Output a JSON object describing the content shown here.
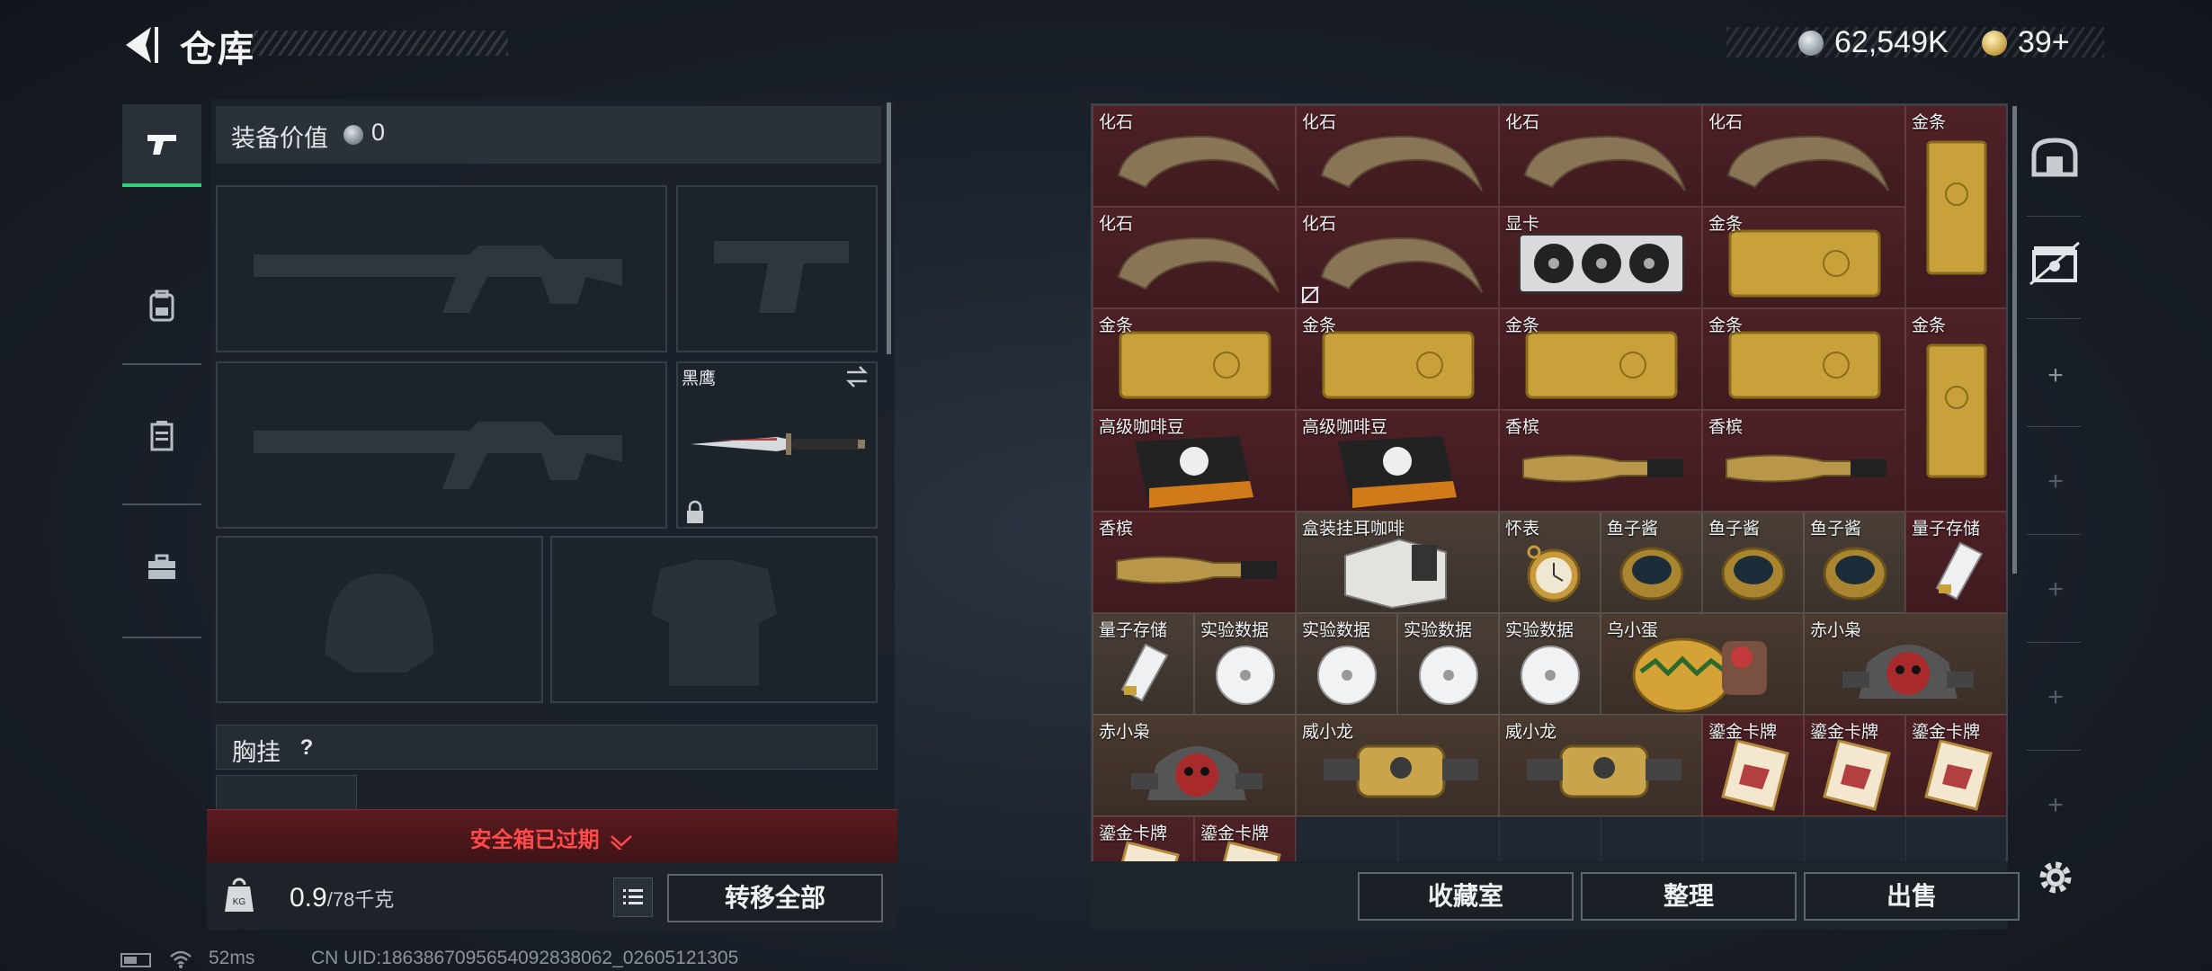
{
  "header": {
    "title": "仓库",
    "back_icon": "back-arrow-icon",
    "silver_currency": "62,549K",
    "gold_currency": "39+"
  },
  "left_tabs": [
    {
      "icon": "pistol-icon",
      "active": true
    },
    {
      "icon": "backpack-icon",
      "active": false
    },
    {
      "icon": "container-icon",
      "active": false
    },
    {
      "icon": "toolbox-icon",
      "active": false
    }
  ],
  "equipment": {
    "value_label": "装备价值",
    "value": "0",
    "melee_name": "黑鹰",
    "vest_label": "胸挂",
    "vest_help": "?",
    "safe_box_status": "安全箱已过期",
    "weight_value": "0.9",
    "weight_max": "/78千克",
    "transfer_all": "转移全部"
  },
  "stash_items": [
    {
      "name": "化石"
    },
    {
      "name": "化石"
    },
    {
      "name": "化石"
    },
    {
      "name": "化石"
    },
    {
      "name": "金条"
    },
    {
      "name": "化石"
    },
    {
      "name": "化石"
    },
    {
      "name": "显卡"
    },
    {
      "name": "金条"
    },
    {
      "name": "金条"
    },
    {
      "name": "金条"
    },
    {
      "name": "金条"
    },
    {
      "name": "金条"
    },
    {
      "name": "金条"
    },
    {
      "name": "高级咖啡豆"
    },
    {
      "name": "高级咖啡豆"
    },
    {
      "name": "香槟"
    },
    {
      "name": "香槟"
    },
    {
      "name": "香槟"
    },
    {
      "name": "盒装挂耳咖啡"
    },
    {
      "name": "怀表"
    },
    {
      "name": "鱼子酱"
    },
    {
      "name": "鱼子酱"
    },
    {
      "name": "鱼子酱"
    },
    {
      "name": "量子存储"
    },
    {
      "name": "量子存储"
    },
    {
      "name": "实验数据"
    },
    {
      "name": "实验数据"
    },
    {
      "name": "实验数据"
    },
    {
      "name": "实验数据"
    },
    {
      "name": "乌小蛋"
    },
    {
      "name": "赤小枭"
    },
    {
      "name": "赤小枭"
    },
    {
      "name": "威小龙"
    },
    {
      "name": "威小龙"
    },
    {
      "name": "鎏金卡牌"
    },
    {
      "name": "鎏金卡牌"
    },
    {
      "name": "鎏金卡牌"
    },
    {
      "name": "鎏金卡牌"
    },
    {
      "name": "鎏金卡牌"
    }
  ],
  "side_icons": [
    "safe-icon",
    "chest-icon"
  ],
  "buttons": {
    "collection": "收藏室",
    "organize": "整理",
    "sell": "出售"
  },
  "status_bar": {
    "ping": "52ms",
    "uid": "CN UID:1863867095654092838062_02605121305"
  }
}
